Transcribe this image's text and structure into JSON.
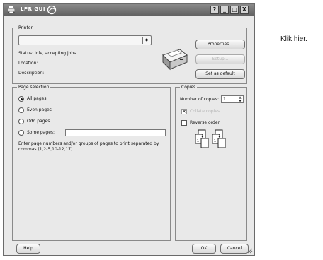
{
  "window": {
    "title": "LPR GUI",
    "controls": {
      "help": "?",
      "minimize": "_",
      "maximize": "□",
      "close": "X"
    }
  },
  "printer": {
    "group_label": "Printer",
    "selected_printer": "",
    "status": "Status: idle, accepting jobs",
    "location": "Location:",
    "description": "Description:",
    "properties_button": "Properties...",
    "setup_button": "Setup...",
    "default_button": "Set as default"
  },
  "page_selection": {
    "group_label": "Page selection",
    "options": [
      "All pages",
      "Even pages",
      "Odd pages",
      "Some pages:"
    ],
    "selected": "All pages",
    "pages_value": "",
    "hint": "Enter page numbers and/or groups of pages to print separated by commas (1,2-5,10-12,17)."
  },
  "copies": {
    "group_label": "Copies",
    "number_label": "Number of copies:",
    "number_value": "1",
    "collate_label": "Collate copies",
    "reverse_label": "Reverse order",
    "collate_page_labels": [
      "1",
      "2",
      "1",
      "2"
    ]
  },
  "footer": {
    "help_button": "Help",
    "ok_button": "OK",
    "cancel_button": "Cancel"
  },
  "annotation": {
    "text": "Klik hier."
  },
  "icons": {
    "app": "printer-app-icon",
    "title_decoration": "swirl-icon",
    "printer_picture": "printer-icon",
    "collate_picture": "collate-pages-icon",
    "combo_arrow": "dropdown-arrow-icon",
    "resize_grip": "resize-grip-icon"
  }
}
